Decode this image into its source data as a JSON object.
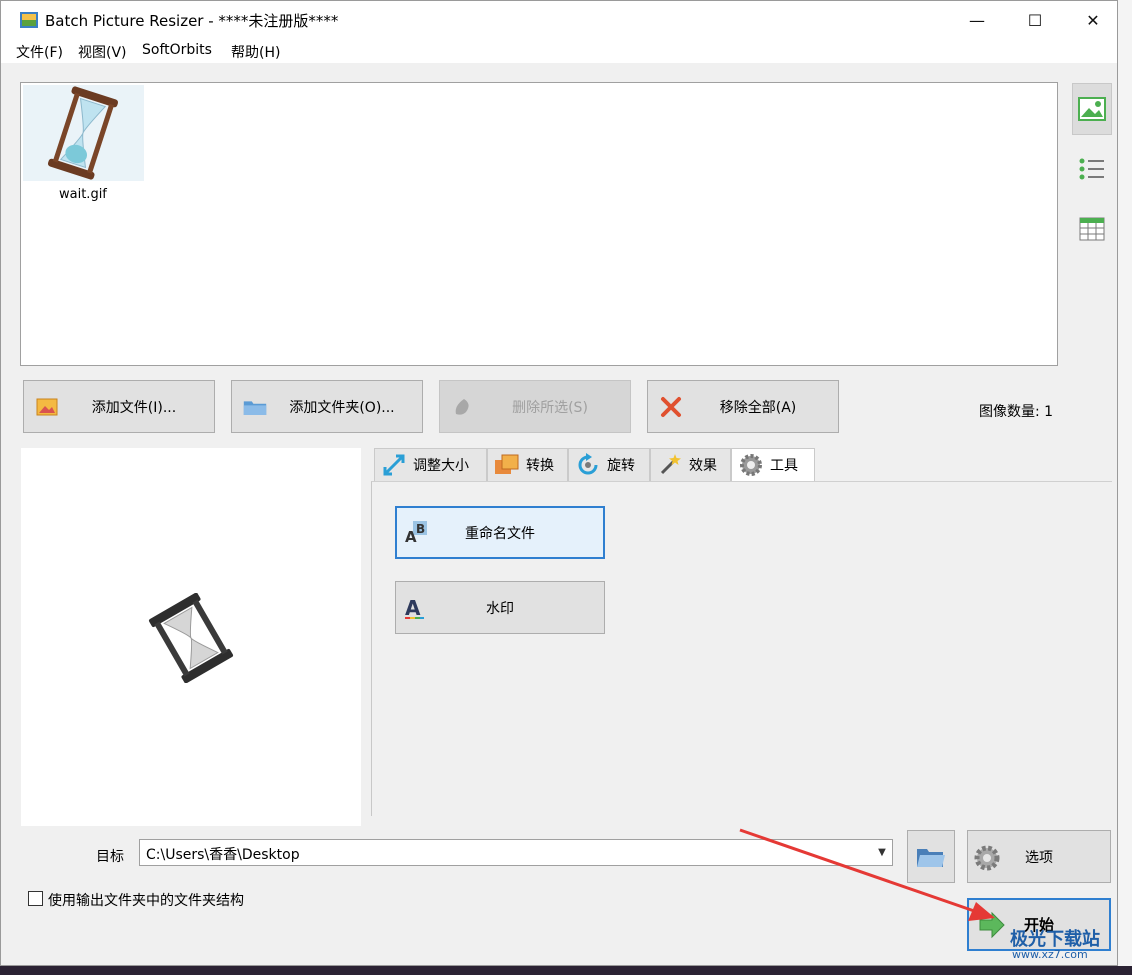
{
  "window": {
    "title": "Batch Picture Resizer - ****未注册版****",
    "min": "—",
    "max": "☐",
    "close": "✕"
  },
  "menu": {
    "file": "文件(F)",
    "view": "视图(V)",
    "softorbits": "SoftOrbits",
    "help": "帮助(H)"
  },
  "file_list": {
    "items": [
      {
        "name": "wait.gif"
      }
    ]
  },
  "actions": {
    "add_file": "添加文件(I)...",
    "add_folder": "添加文件夹(O)...",
    "delete_selected": "删除所选(S)",
    "remove_all": "移除全部(A)"
  },
  "image_count": "图像数量: 1",
  "tabs": {
    "resize": "调整大小",
    "convert": "转换",
    "rotate": "旋转",
    "effects": "效果",
    "tools": "工具"
  },
  "tools": {
    "rename": "重命名文件",
    "watermark": "水印"
  },
  "destination": {
    "label": "目标",
    "path": "C:\\Users\\香香\\Desktop"
  },
  "options_label": "选项",
  "start_label": "开始",
  "checkbox_label": "使用输出文件夹中的文件夹结构",
  "site_watermark": {
    "title": "极光下载站",
    "url": "www.xz7.com"
  },
  "colors": {
    "accent": "#2f7fd0",
    "annotation": "#e53935"
  }
}
